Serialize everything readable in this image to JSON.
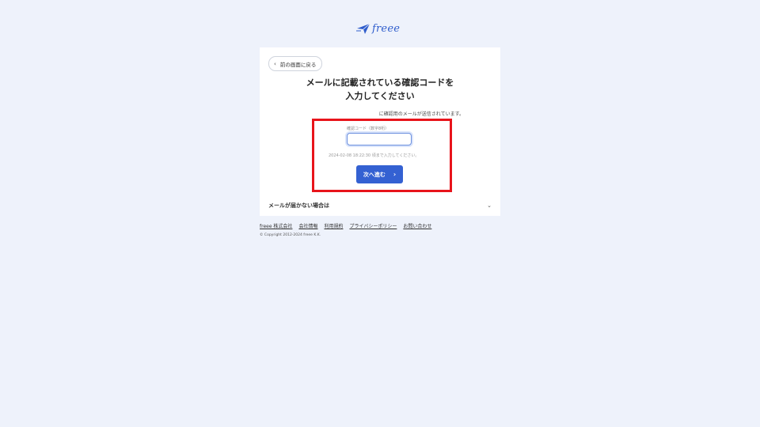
{
  "brand": {
    "name": "freee",
    "color": "#2f5dcc"
  },
  "card": {
    "back_label": "前の画面に戻る",
    "title_line1": "メールに記載されている確認コードを",
    "title_line2": "入力してください",
    "sent_note": "に確認用のメールが送信されています。",
    "code_label": "確認コード（数字8桁）",
    "code_value": "",
    "deadline": "2024-02-08 18:22:30 頃まで入力してください。",
    "next_label": "次へ進む",
    "faq_label": "メールが届かない場合は"
  },
  "footer": {
    "links": [
      "freee 株式会社",
      "会社情報",
      "利用規約",
      "プライバシーポリシー",
      "お問い合わせ"
    ],
    "copyright": "© Copyright 2012-2024 freee K.K."
  },
  "colors": {
    "background": "#eef2fb",
    "primary_button": "#3461d2",
    "highlight_box": "#e8141b"
  }
}
